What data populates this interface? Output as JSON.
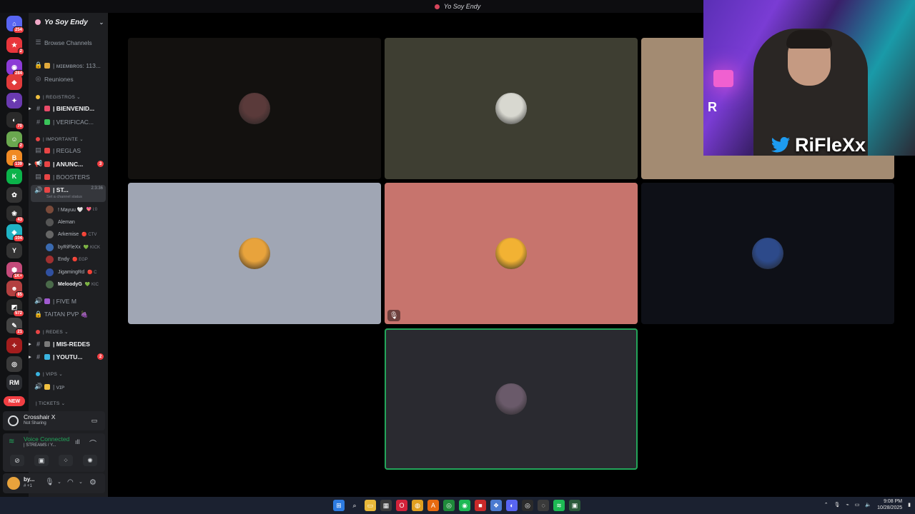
{
  "window": {
    "title": "Yo Soy Endy"
  },
  "rail": {
    "servers": [
      {
        "label": "⌂",
        "badge": "254",
        "color": "#5865f2"
      },
      {
        "label": "★",
        "badge": "2",
        "color": "#e9353b"
      },
      {
        "label": "◉",
        "badge": "284",
        "color": "#8c3bd6"
      },
      {
        "label": "◆",
        "badge": "",
        "color": "#e23b3b"
      },
      {
        "label": "✦",
        "badge": "",
        "color": "#6a3ab0"
      },
      {
        "label": "◐",
        "badge": "70",
        "color": "#2a2a2a"
      },
      {
        "label": "☺",
        "badge": "2",
        "color": "#6aa84f"
      },
      {
        "label": "B",
        "badge": "139",
        "color": "#f08a24"
      },
      {
        "label": "K",
        "badge": "",
        "color": "#0bb34a"
      },
      {
        "label": "✿",
        "badge": "",
        "color": "#333"
      },
      {
        "label": "❀",
        "badge": "43",
        "color": "#2d2d2d"
      },
      {
        "label": "◈",
        "badge": "104",
        "color": "#1fb3c4"
      },
      {
        "label": "Y",
        "badge": "",
        "color": "#333"
      },
      {
        "label": "⬢",
        "badge": "1K+",
        "color": "#c44a7a"
      },
      {
        "label": "☻",
        "badge": "85",
        "color": "#b34040"
      },
      {
        "label": "◩",
        "badge": "572",
        "color": "#2a2a2a"
      },
      {
        "label": "✎",
        "badge": "21",
        "color": "#444"
      },
      {
        "label": "✧",
        "badge": "",
        "color": "#a31d1d"
      },
      {
        "label": "◎",
        "badge": "",
        "color": "#3a3a3a"
      },
      {
        "label": "RM",
        "badge": "",
        "color": "#2b2d31"
      }
    ],
    "new_label": "NEW"
  },
  "sidebar": {
    "guild_name": "Yo Soy Endy",
    "browse": "Browse Channels",
    "items": [
      {
        "kind": "channel",
        "icon": "🔒",
        "emo": "#e0a93c",
        "label": "| ᴍɪᴇᴍʙʀᴏs: 113...",
        "bold": false
      },
      {
        "kind": "channel",
        "icon": "◎",
        "emo": "",
        "label": "Reuniones",
        "bold": false
      },
      {
        "kind": "category",
        "emo": "#f0c040",
        "label": "| REGISTROS ⌄"
      },
      {
        "kind": "channel",
        "icon": "#",
        "emo": "#e94b6a",
        "label": "| BIENVENID...",
        "bold": true,
        "arrow": true
      },
      {
        "kind": "channel",
        "icon": "#",
        "emo": "#3ac45a",
        "label": "| VERIFICAC...",
        "bold": false
      },
      {
        "kind": "category",
        "emo": "#e84545",
        "label": "| IMPORTANTE ⌄"
      },
      {
        "kind": "channel",
        "icon": "▤",
        "emo": "#e84545",
        "label": "| REGLAS",
        "bold": false
      },
      {
        "kind": "channel",
        "icon": "📢",
        "emo": "#e84545",
        "label": "| ANUNC...",
        "bold": true,
        "arrow": true,
        "pill": "3"
      },
      {
        "kind": "channel",
        "icon": "▤",
        "emo": "#e84545",
        "label": "| BOOSTERS",
        "bold": false
      }
    ],
    "voice_channel": {
      "label": "| ST...",
      "time": "2:3:36",
      "status": "Set a channel status"
    },
    "voice_users": [
      {
        "name": "! Mayuu 🤍",
        "status": "💖 i:0",
        "color": "#7a4a3a"
      },
      {
        "name": "Aleman",
        "status": "",
        "color": "#555"
      },
      {
        "name": "Arkemise",
        "status": "🔴 CTV",
        "color": "#666"
      },
      {
        "name": "byRiFleXx",
        "status": "💚 KICK",
        "color": "#3a6ab0"
      },
      {
        "name": "Endy",
        "status": "🔴 EGP",
        "color": "#a03030"
      },
      {
        "name": "JigamingRd",
        "status": "🔴 C",
        "color": "#3050a0"
      },
      {
        "name": "MeloodyG",
        "status": "💚 KIC",
        "color": "#4a6a4a"
      }
    ],
    "items2": [
      {
        "kind": "channel",
        "icon": "🔊",
        "emo": "#a05ad0",
        "label": "| FIVE M",
        "bold": false
      },
      {
        "kind": "channel",
        "icon": "🔒",
        "emo": "",
        "label": "TAITAN PVP 🍇",
        "bold": false
      },
      {
        "kind": "category",
        "emo": "#e84545",
        "label": "| REDES ⌄"
      },
      {
        "kind": "channel",
        "icon": "#",
        "emo": "#7a7a7a",
        "label": "| MIS-REDES",
        "bold": true,
        "arrow": true
      },
      {
        "kind": "channel",
        "icon": "#",
        "emo": "#3ab4e0",
        "label": "| YOUTU...",
        "bold": true,
        "arrow": true,
        "pill": "2"
      },
      {
        "kind": "category",
        "emo": "#3ab4e0",
        "label": "| VIPS ⌄"
      },
      {
        "kind": "channel",
        "icon": "🔊",
        "emo": "#f0c040",
        "label": "| ᴠɪᴘ",
        "bold": false
      },
      {
        "kind": "category",
        "emo": "",
        "label": "| TICKETS ⌄"
      }
    ]
  },
  "activity": {
    "app": "Crosshair X",
    "status": "Not Sharing"
  },
  "voice_panel": {
    "title": "Voice Connected",
    "channel": "| STREAMS / Y..."
  },
  "user_panel": {
    "name": "by...",
    "status": "# +1"
  },
  "tiles": [
    {
      "bg": "#13110f",
      "avatar": "#5a3a3a",
      "muted": false,
      "speaking": false
    },
    {
      "bg": "#3e3e32",
      "avatar": "#d8d8d0",
      "muted": false,
      "speaking": false
    },
    {
      "bg": "#a38b72",
      "avatar": "#5a4a3a",
      "muted": false,
      "speaking": false
    },
    {
      "bg": "#a0a6b4",
      "avatar": "#e8a33c",
      "muted": false,
      "speaking": false
    },
    {
      "bg": "#c7746d",
      "avatar": "#f2b233",
      "muted": true,
      "speaking": false
    },
    {
      "bg": "#0e1017",
      "avatar": "#2d4a8a",
      "muted": false,
      "speaking": false
    },
    {
      "bg": "#2a2a30",
      "avatar": "#6a5a6a",
      "muted": false,
      "speaking": true
    }
  ],
  "facecam": {
    "handle": "RiFleXx"
  },
  "taskbar": {
    "time": "9:08 PM",
    "date": "10/28/2025",
    "icons": [
      {
        "name": "windows-icon",
        "color": "#2d7be0",
        "glyph": "⊞"
      },
      {
        "name": "search-icon",
        "color": "transparent",
        "glyph": "⌕"
      },
      {
        "name": "file-explorer-icon",
        "color": "#e8b83a",
        "glyph": "▭"
      },
      {
        "name": "store-icon",
        "color": "#3a3a3a",
        "glyph": "▦"
      },
      {
        "name": "opera-icon",
        "color": "#d3223a",
        "glyph": "O"
      },
      {
        "name": "chrome-icon",
        "color": "#e0a020",
        "glyph": "◍"
      },
      {
        "name": "app-a-icon",
        "color": "#e86a10",
        "glyph": "A"
      },
      {
        "name": "xbox-icon",
        "color": "#1e8a3a",
        "glyph": "◎"
      },
      {
        "name": "spotify-green-icon",
        "color": "#1db954",
        "glyph": "◉"
      },
      {
        "name": "app-red-icon",
        "color": "#c92a2a",
        "glyph": "■"
      },
      {
        "name": "app-multi-icon",
        "color": "#4a7ad0",
        "glyph": "❖"
      },
      {
        "name": "discord-icon",
        "color": "#5865f2",
        "glyph": "◐"
      },
      {
        "name": "obs-icon",
        "color": "#2b2b2b",
        "glyph": "◎"
      },
      {
        "name": "steam-icon",
        "color": "#3a3a3a",
        "glyph": "◌"
      },
      {
        "name": "spotify-icon",
        "color": "#1db954",
        "glyph": "≋"
      },
      {
        "name": "app-green-icon",
        "color": "#2a5a3a",
        "glyph": "▣"
      }
    ]
  }
}
